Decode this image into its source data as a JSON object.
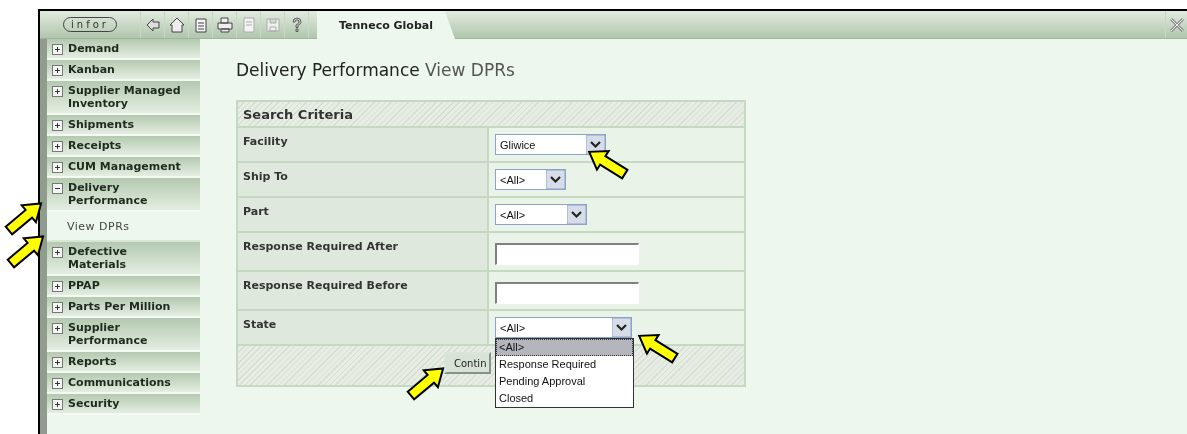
{
  "toolbar": {
    "logo": "infor",
    "tools": [
      {
        "kind": "back",
        "disabled": false
      },
      {
        "kind": "home",
        "disabled": false
      },
      {
        "kind": "document",
        "disabled": false
      },
      {
        "kind": "print",
        "disabled": false
      },
      {
        "kind": "page",
        "disabled": true
      },
      {
        "kind": "save",
        "disabled": true
      },
      {
        "kind": "help",
        "disabled": false
      }
    ],
    "tabs": [
      {
        "label": "Tenneco Global",
        "selected": true
      }
    ]
  },
  "sidebar": {
    "items": [
      {
        "label": "Demand",
        "expanded": false
      },
      {
        "label": "Kanban",
        "expanded": false
      },
      {
        "label": "Supplier Managed Inventory",
        "expanded": false
      },
      {
        "label": "Shipments",
        "expanded": false
      },
      {
        "label": "Receipts",
        "expanded": false
      },
      {
        "label": "CUM Management",
        "expanded": false
      },
      {
        "label": "Delivery Performance",
        "expanded": true,
        "children": [
          {
            "label": "View DPRs",
            "selected": true
          }
        ]
      },
      {
        "label": "Defective Materials",
        "expanded": false
      },
      {
        "label": "PPAP",
        "expanded": false
      },
      {
        "label": "Parts Per Million",
        "expanded": false
      },
      {
        "label": "Supplier Performance",
        "expanded": false
      },
      {
        "label": "Reports",
        "expanded": false
      },
      {
        "label": "Communications",
        "expanded": false
      },
      {
        "label": "Security",
        "expanded": false
      }
    ]
  },
  "page": {
    "title": "Delivery Performance",
    "subtitle": "View DPRs"
  },
  "search": {
    "title": "Search Criteria",
    "fields": [
      {
        "label": "Facility",
        "kind": "select",
        "value": "Gliwice"
      },
      {
        "label": "Ship To",
        "kind": "select",
        "value": "<All>"
      },
      {
        "label": "Part",
        "kind": "select",
        "value": "<All>"
      },
      {
        "label": "Response Required After",
        "kind": "text"
      },
      {
        "label": "Response Required Before",
        "kind": "text"
      },
      {
        "label": "State",
        "kind": "select",
        "value": "<All>",
        "open": true,
        "options": [
          {
            "label": "<All>",
            "selected": true
          },
          {
            "label": "Response Required",
            "selected": false
          },
          {
            "label": "Pending Approval",
            "selected": false
          },
          {
            "label": "Closed",
            "selected": false
          }
        ]
      }
    ],
    "button": "Contin"
  }
}
